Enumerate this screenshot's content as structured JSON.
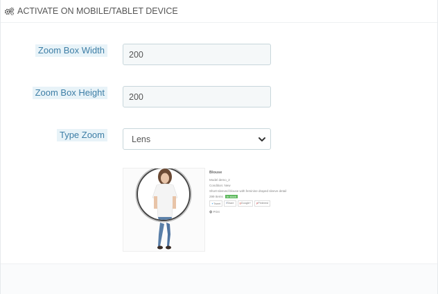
{
  "panel": {
    "icon": "gears-icon",
    "title": "ACTIVATE ON MOBILE/TABLET DEVICE"
  },
  "fields": {
    "zoom_box_width": {
      "label": "Zoom Box Width",
      "value": "200"
    },
    "zoom_box_height": {
      "label": "Zoom Box Height",
      "value": "200"
    },
    "type_zoom": {
      "label": "Type Zoom",
      "selected": "Lens",
      "icon": "chevron-down-icon"
    }
  },
  "preview": {
    "product_name": "Blouse",
    "lines": [
      "Model demo_2",
      "Condition: New",
      "Short-sleeved blouse with feminine draped sleeve detail"
    ],
    "stock_label": "299 Items",
    "stock_badge": "In stock",
    "share": {
      "tweet": "Tweet",
      "share": "Share",
      "google": "Google+",
      "pinterest": "Pinterest"
    },
    "print": "Print"
  },
  "colors": {
    "label_bg": "#e8f3f8",
    "label_text": "#3d7ea6",
    "input_border": "#c7d6db",
    "input_bg": "#f5f8f9",
    "stock_green": "#5cb85c"
  }
}
